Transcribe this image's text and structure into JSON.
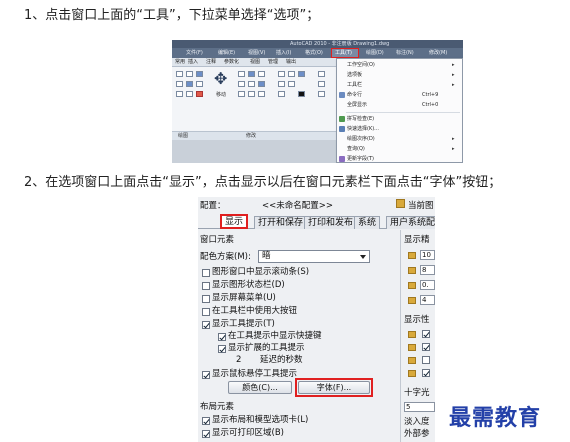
{
  "steps": {
    "step1": "1、点击窗口上面的“工具”，下拉菜单选择“选项”；",
    "step2": "2、在选项窗口上面点击“显示”，点击显示以后在窗口元素栏下面点击“字体”按钮；"
  },
  "shot1": {
    "title": "AutoCAD 2010 - 非注册版    Drawing1.dwg",
    "menubar": [
      "文件(F)",
      "编辑(E)",
      "视图(V)",
      "插入(I)",
      "格式(O)",
      "工具(T)",
      "绘图(D)",
      "标注(N)",
      "修改(M)"
    ],
    "ribbon_tabs": [
      "常用",
      "插入",
      "注释",
      "参数化",
      "视图",
      "管理",
      "输出"
    ],
    "ribbon_group_labels": [
      "绘图",
      "修改"
    ],
    "ribbon_big_button": "移动",
    "dropdown": {
      "items": [
        {
          "label": "工作空间(O)",
          "shortcut": "",
          "arrow": true
        },
        {
          "label": "选项板",
          "shortcut": "",
          "arrow": true
        },
        {
          "label": "工具栏",
          "shortcut": "",
          "arrow": true
        },
        {
          "label": "命令行",
          "shortcut": "Ctrl+9",
          "arrow": false
        },
        {
          "label": "全屏显示",
          "shortcut": "Ctrl+0",
          "arrow": false
        },
        {
          "label": "拼写检查(E)",
          "shortcut": "",
          "arrow": false
        },
        {
          "label": "快速选择(K)...",
          "shortcut": "",
          "arrow": false
        },
        {
          "label": "绘图次序(D)",
          "shortcut": "",
          "arrow": true
        },
        {
          "label": "查询(Q)",
          "shortcut": "",
          "arrow": true
        },
        {
          "label": "更新字段(T)",
          "shortcut": "",
          "arrow": false
        }
      ]
    }
  },
  "shot2": {
    "current_config_label": "配置：",
    "current_config_value": "<<未命名配置>>",
    "current_drawing_label": "当前图",
    "tabs": [
      "显示",
      "打开和保存",
      "打印和发布",
      "系统",
      "用户系统配置"
    ],
    "window_elements_header": "窗口元素",
    "color_scheme_label": "配色方案(M):",
    "color_scheme_value": "暗",
    "options": [
      {
        "label": "图形窗口中显示滚动条(S)",
        "checked": false
      },
      {
        "label": "显示图形状态栏(D)",
        "checked": false
      },
      {
        "label": "显示屏幕菜单(U)",
        "checked": false
      },
      {
        "label": "在工具栏中使用大按钮",
        "checked": false
      },
      {
        "label": "显示工具提示(T)",
        "checked": true
      }
    ],
    "sub_options": [
      {
        "label": "在工具提示中显示快捷键",
        "checked": true
      },
      {
        "label": "显示扩展的工具提示",
        "checked": true
      }
    ],
    "delay_value": "2",
    "delay_label": "延迟的秒数",
    "rollover_label": "显示鼠标悬停工具提示",
    "colors_button": "颜色(C)...",
    "fonts_button": "字体(F)...",
    "layout_elements_header": "布局元素",
    "layout_options": [
      {
        "label": "显示布局和模型选项卡(L)",
        "checked": true
      },
      {
        "label": "显示可打印区域(B)",
        "checked": true
      }
    ],
    "right_headers": [
      "显示精",
      "显示性",
      "十字光",
      "淡入度"
    ],
    "right_values": [
      "10",
      "8",
      "0.",
      "4"
    ],
    "right_crosshair_value": "5",
    "right_bottom_label": "外部参"
  },
  "watermark": "最需教育",
  "colors": {
    "highlight_red": "#e02020",
    "menubar_blue": "#5d6f88",
    "watermark_blue": "#2340a8"
  }
}
